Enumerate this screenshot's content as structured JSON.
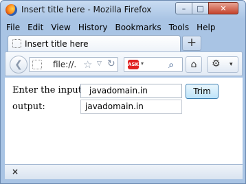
{
  "window": {
    "title": "Insert title here - Mozilla Firefox",
    "controls": {
      "minimize": "–",
      "maximize": "□",
      "close": "✕"
    }
  },
  "menubar": {
    "items": [
      "File",
      "Edit",
      "View",
      "History",
      "Bookmarks",
      "Tools",
      "Help"
    ]
  },
  "tabs": [
    {
      "label": "Insert title here",
      "active": true
    }
  ],
  "new_tab_label": "+",
  "navbar": {
    "url": "file://.",
    "back_icon": "back-arrow-icon",
    "star_icon": "bookmark-star-icon",
    "reload_icon": "reload-icon",
    "search_engine_icon": "ask-logo",
    "search_icon": "magnifier-icon",
    "home_icon": "home-icon",
    "addon_icon": "addon-icon"
  },
  "form": {
    "input_label": "Enter the input :",
    "input_value": "javadomain.in",
    "trim_button": "Trim",
    "output_label": "output:",
    "output_value": "javadomain.in"
  },
  "statusbar": {
    "close_label": "×"
  },
  "colors": {
    "chrome_blue": "#a9c4e4",
    "close_red": "#c4432c",
    "button_blue": "#bde4f9"
  }
}
